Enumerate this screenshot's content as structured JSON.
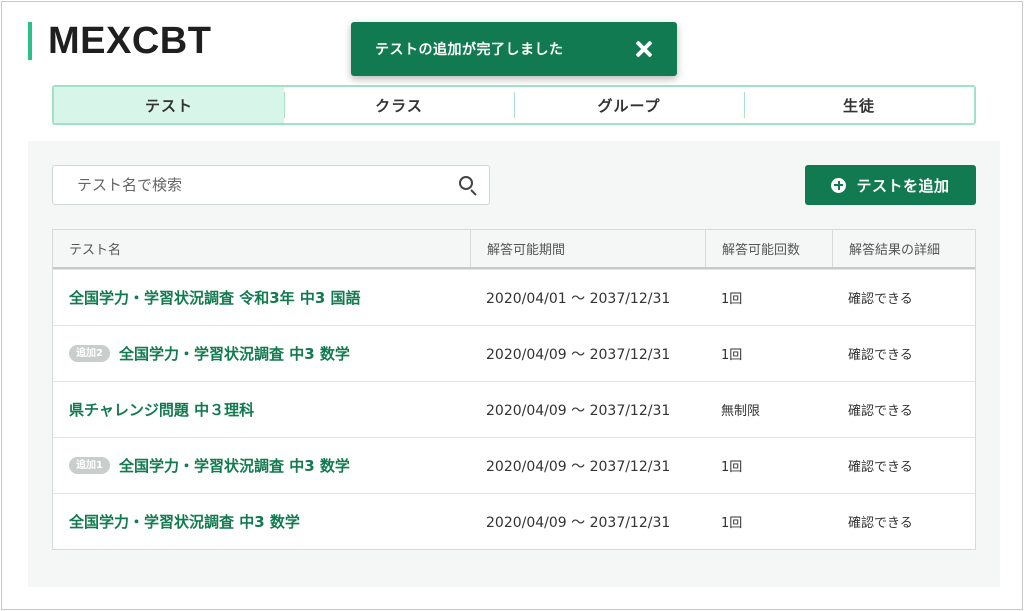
{
  "brand": {
    "name": "MEXCBT",
    "accent_color": "#2bbf8a"
  },
  "toast": {
    "message": "テストの追加が完了しました",
    "close_icon": "close-icon",
    "bg_color": "#127a50"
  },
  "tabs": [
    {
      "label": "テスト",
      "active": true
    },
    {
      "label": "クラス",
      "active": false
    },
    {
      "label": "グループ",
      "active": false
    },
    {
      "label": "生徒",
      "active": false
    }
  ],
  "search": {
    "placeholder": "テスト名で検索",
    "value": "",
    "icon": "search-icon"
  },
  "add_button": {
    "label": "テストを追加",
    "icon": "plus-circle-icon",
    "color": "#127a50"
  },
  "table": {
    "headers": [
      "テスト名",
      "解答可能期間",
      "解答可能回数",
      "解答結果の詳細"
    ],
    "rows": [
      {
        "badge": "",
        "name": "全国学力・学習状況調査 令和3年 中3 国語",
        "period": "2020/04/01 ～ 2037/12/31",
        "attempts": "1回",
        "detail": "確認できる"
      },
      {
        "badge": "追加2",
        "name": "全国学力・学習状況調査 中3 数学",
        "period": "2020/04/09 ～ 2037/12/31",
        "attempts": "1回",
        "detail": "確認できる"
      },
      {
        "badge": "",
        "name": "県チャレンジ問題 中３理科",
        "period": "2020/04/09 ～ 2037/12/31",
        "attempts": "無制限",
        "detail": "確認できる"
      },
      {
        "badge": "追加1",
        "name": "全国学力・学習状況調査 中3 数学",
        "period": "2020/04/09 ～ 2037/12/31",
        "attempts": "1回",
        "detail": "確認できる"
      },
      {
        "badge": "",
        "name": "全国学力・学習状況調査 中3 数学",
        "period": "2020/04/09 ～ 2037/12/31",
        "attempts": "1回",
        "detail": "確認できる"
      }
    ]
  }
}
